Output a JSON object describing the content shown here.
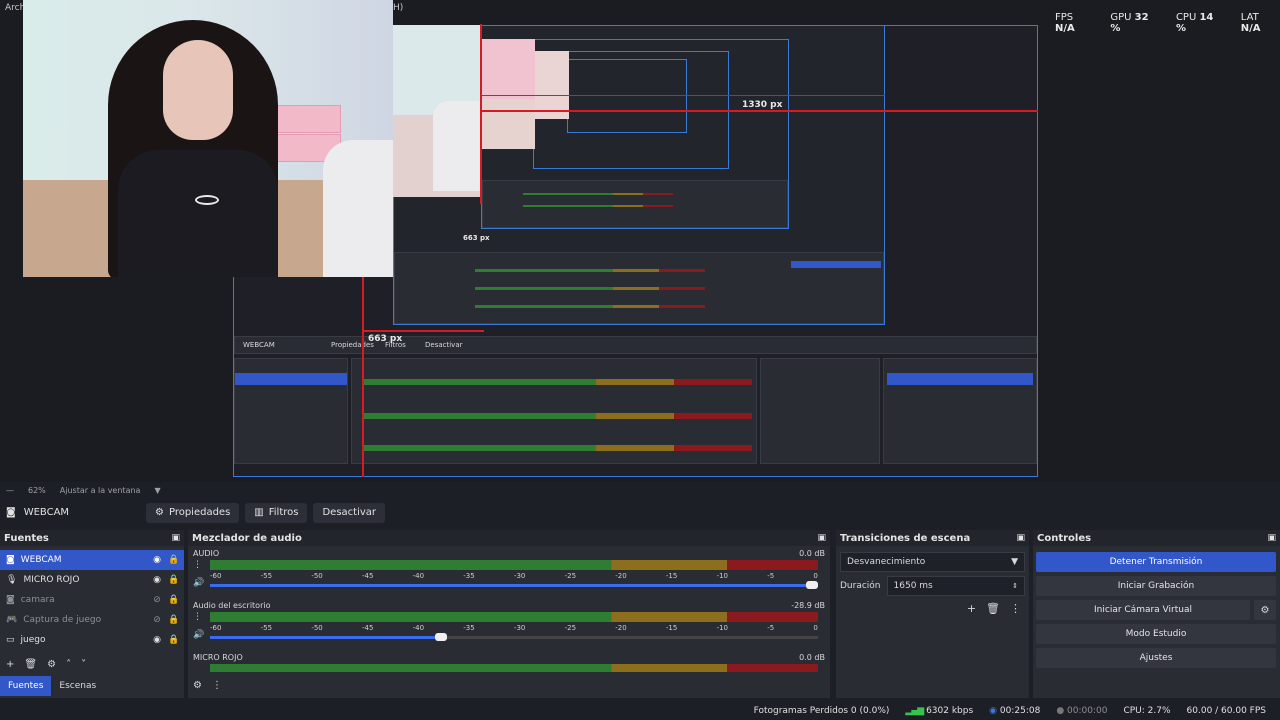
{
  "preview": {
    "menu_text_left": "Arch",
    "menu_text_right": "H)",
    "stats": {
      "fps_label": "FPS",
      "fps_value": "N/A",
      "gpu_label": "GPU",
      "gpu_value": "32 %",
      "cpu_label": "CPU",
      "cpu_value": "14 %",
      "lat_label": "LAT",
      "lat_value": "N/A"
    },
    "measure_1330": "1330 px",
    "measure_663": "663 px",
    "nested_tabs": [
      "WEBCAM",
      "Propiedades",
      "Filtros",
      "Desactivar"
    ]
  },
  "zoom": {
    "value": "62%",
    "fit_label": "Ajustar a la ventana"
  },
  "source_toolbar": {
    "source_name": "WEBCAM",
    "properties": "Propiedades",
    "filters": "Filtros",
    "deactivate": "Desactivar"
  },
  "sources": {
    "title": "Fuentes",
    "items": [
      {
        "label": "WEBCAM",
        "icon": "camera-icon",
        "visible": true
      },
      {
        "label": "MICRO ROJO",
        "icon": "microphone-icon",
        "visible": true
      },
      {
        "label": "camara",
        "icon": "camera-icon",
        "visible": false
      },
      {
        "label": "Captura de juego",
        "icon": "gamepad-icon",
        "visible": false
      },
      {
        "label": "juego",
        "icon": "window-icon",
        "visible": true
      }
    ],
    "tabs": [
      "Fuentes",
      "Escenas"
    ]
  },
  "mixer": {
    "title": "Mezclador de audio",
    "scale": [
      "-60",
      "-55",
      "-50",
      "-45",
      "-40",
      "-35",
      "-30",
      "-25",
      "-20",
      "-15",
      "-10",
      "-5",
      "0"
    ],
    "channels": [
      {
        "name": "AUDIO",
        "db": "0.0 dB",
        "volume_fraction": 1.0
      },
      {
        "name": "Audio del escritorio",
        "db": "-28.9 dB",
        "volume_fraction": 0.38
      },
      {
        "name": "MICRO ROJO",
        "db": "0.0 dB",
        "volume_fraction": 1.0
      }
    ]
  },
  "transitions": {
    "title": "Transiciones de escena",
    "selected": "Desvanecimiento",
    "duration_label": "Duración",
    "duration_value": "1650 ms"
  },
  "controls": {
    "title": "Controles",
    "stop_stream": "Detener Transmisión",
    "start_recording": "Iniciar Grabación",
    "start_virtual_cam": "Iniciar Cámara Virtual",
    "studio_mode": "Modo Estudio",
    "settings": "Ajustes"
  },
  "status": {
    "dropped_frames": "Fotogramas Perdidos 0 (0.0%)",
    "bitrate": "6302 kbps",
    "stream_time": "00:25:08",
    "rec_time": "00:00:00",
    "cpu": "CPU: 2.7%",
    "fps": "60.00 / 60.00 FPS"
  }
}
